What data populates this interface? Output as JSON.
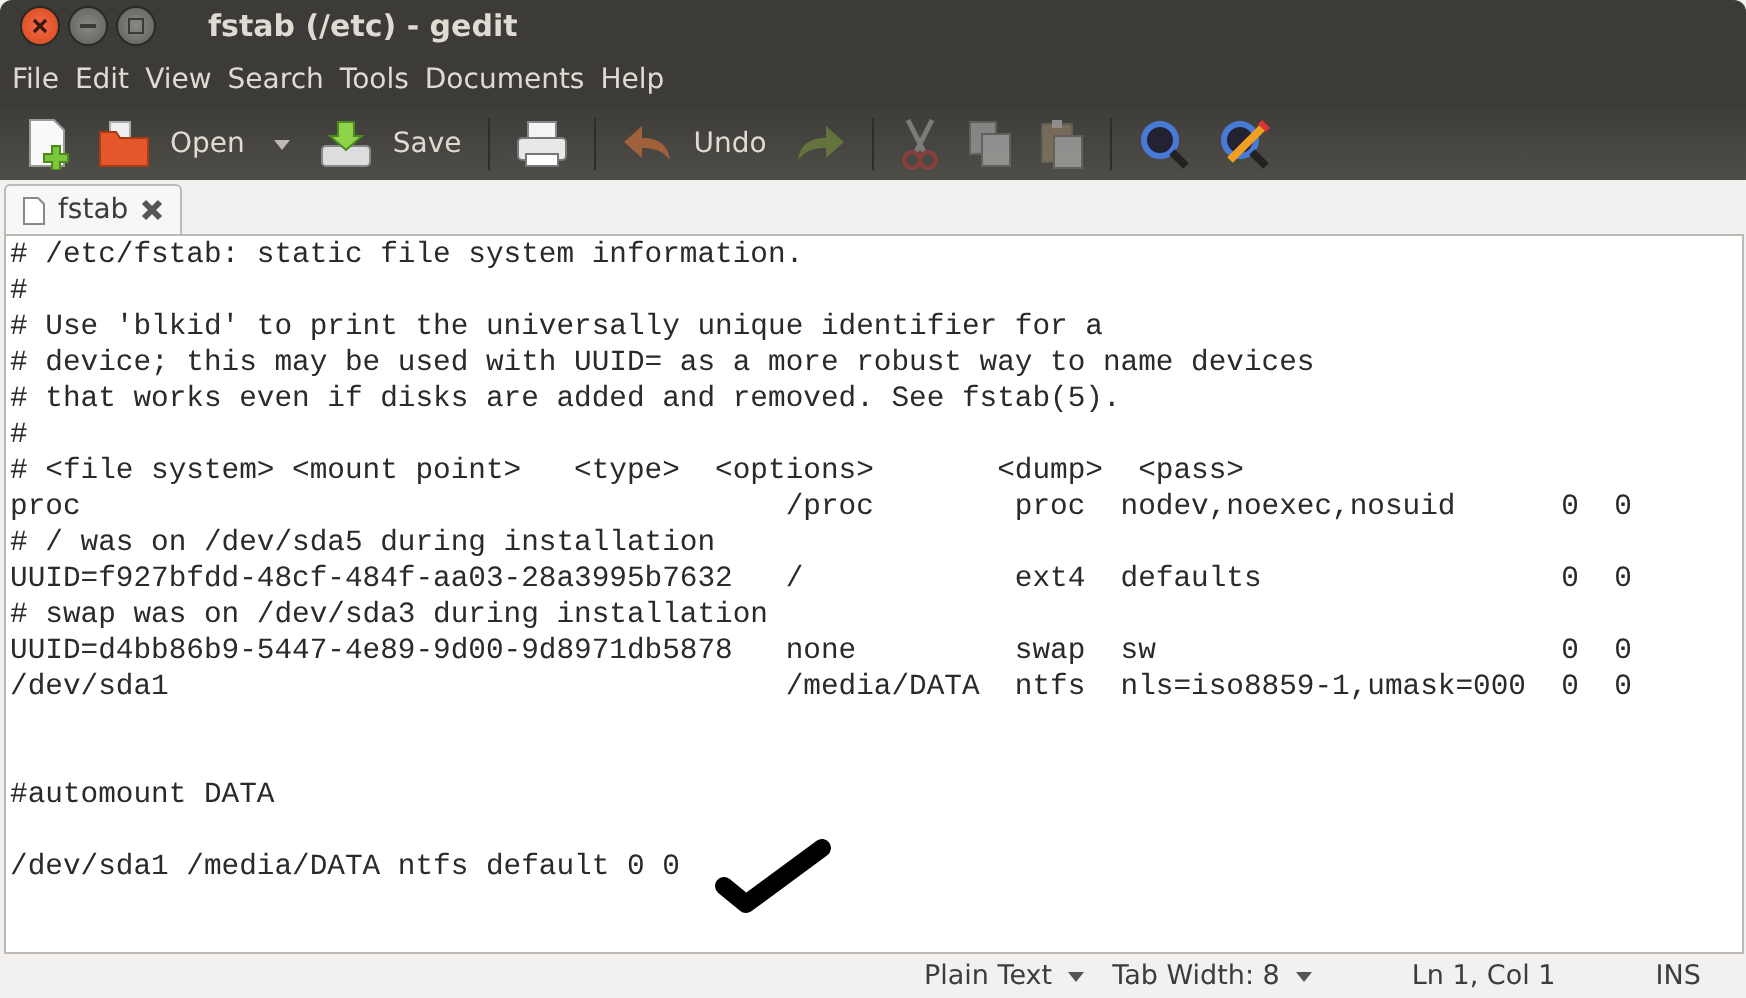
{
  "window": {
    "title": "fstab (/etc) - gedit"
  },
  "menu": [
    "File",
    "Edit",
    "View",
    "Search",
    "Tools",
    "Documents",
    "Help"
  ],
  "toolbar": [
    {
      "kind": "button",
      "disabled": false
    },
    {
      "kind": "button",
      "label": "Open",
      "disabled": false
    },
    {
      "kind": "dropdown"
    },
    {
      "kind": "button",
      "label": "Save",
      "disabled": false
    },
    {
      "kind": "separator"
    },
    {
      "kind": "button",
      "disabled": false
    },
    {
      "kind": "separator"
    },
    {
      "kind": "button",
      "label": "Undo",
      "disabled": false
    },
    {
      "kind": "button",
      "disabled": true
    },
    {
      "kind": "separator"
    },
    {
      "kind": "button",
      "disabled": true
    },
    {
      "kind": "button",
      "disabled": true
    },
    {
      "kind": "button",
      "disabled": true
    },
    {
      "kind": "separator"
    },
    {
      "kind": "button",
      "disabled": false
    },
    {
      "kind": "button",
      "disabled": false
    }
  ],
  "tabs": [
    {
      "label": "fstab",
      "selected": true
    }
  ],
  "editor": {
    "text": "# /etc/fstab: static file system information.\n#\n# Use 'blkid' to print the universally unique identifier for a\n# device; this may be used with UUID= as a more robust way to name devices\n# that works even if disks are added and removed. See fstab(5).\n#\n# <file system> <mount point>   <type>  <options>       <dump>  <pass>\nproc                                        /proc        proc  nodev,noexec,nosuid      0  0\n# / was on /dev/sda5 during installation\nUUID=f927bfdd-48cf-484f-aa03-28a3995b7632   /            ext4  defaults                 0  0\n# swap was on /dev/sda3 during installation\nUUID=d4bb86b9-5447-4e89-9d00-9d8971db5878   none         swap  sw                       0  0\n/dev/sda1                                   /media/DATA  ntfs  nls=iso8859-1,umask=000  0  0\n\n\n#automount DATA\n\n/dev/sda1 /media/DATA ntfs default 0 0"
  },
  "status_bar": {
    "language": "Plain Text",
    "tab_width": "Tab Width:  8",
    "position": "Ln 1, Col 1",
    "mode": "INS"
  }
}
